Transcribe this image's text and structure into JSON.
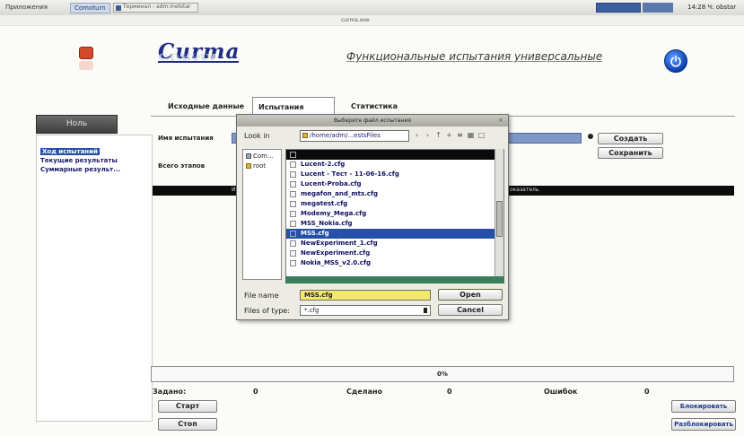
{
  "taskbar": {
    "apps_label": "Приложения",
    "app2_label": "Comoturn",
    "window_label": "Терминал - adm:inetstar",
    "clock": "14:28 Ч: obstar"
  },
  "window": {
    "title": "curma.exe"
  },
  "header": {
    "logo": "Curma",
    "logo_reflection": "CURMA",
    "app_title": "Функциональные испытания универсальные",
    "power_icon": "power-icon",
    "logo_icon": "app-logo-icon"
  },
  "left_panel": {
    "title": "Ноль",
    "items": [
      {
        "label": "Ход испытаний",
        "selected": true
      },
      {
        "label": "Текущие результаты",
        "selected": false
      },
      {
        "label": "Суммарные результ...",
        "selected": false
      }
    ]
  },
  "tabs": [
    {
      "label": "Исходные данные",
      "active": false
    },
    {
      "label": "Испытания",
      "active": true
    },
    {
      "label": "Статистика",
      "active": false
    }
  ],
  "form": {
    "test_name_label": "Имя испытания",
    "total_stages_label": "Всего этапов",
    "create_button": "Создать",
    "save_button": "Сохранить",
    "stage_bar_left": "Ин",
    "stage_bar_right": "оказатель"
  },
  "progress": {
    "value_percent": 0,
    "label": "0%"
  },
  "stats": {
    "assigned_label": "Задано:",
    "assigned_value": "0",
    "done_label": "Сделано",
    "done_value": "0",
    "errors_label": "Ошибок",
    "errors_value": "0"
  },
  "controls": {
    "start_button": "Старт",
    "stop_button": "Стоп",
    "lock_button": "Блокировать",
    "unlock_button": "Разблокировать"
  },
  "dialog": {
    "title": "Выберите файл испытания",
    "look_in_label": "Look in",
    "look_in_value": "/home/adm/...estsFiles",
    "places": [
      {
        "label": "Com...",
        "icon": "computer-icon"
      },
      {
        "label": "root",
        "icon": "folder-icon"
      }
    ],
    "files": [
      {
        "name": "",
        "style": "black"
      },
      {
        "name": "Lucent-2.cfg",
        "style": "normal"
      },
      {
        "name": "Lucent - Тест - 11-06-16.cfg",
        "style": "normal"
      },
      {
        "name": "Lucent-Proba.cfg",
        "style": "normal"
      },
      {
        "name": "megafon_and_mts.cfg",
        "style": "normal"
      },
      {
        "name": "megatest.cfg",
        "style": "normal"
      },
      {
        "name": "Modemy_Mega.cfg",
        "style": "normal"
      },
      {
        "name": "MSS_Nokia.cfg",
        "style": "normal"
      },
      {
        "name": "MSS.cfg",
        "style": "selected"
      },
      {
        "name": "NewExperiment_1.cfg",
        "style": "normal"
      },
      {
        "name": "NewExperiment.cfg",
        "style": "normal"
      },
      {
        "name": "Nokia_MSS_v2.0.cfg",
        "style": "normal"
      }
    ],
    "file_name_label": "File name",
    "file_name_value": "MSS.cfg",
    "files_of_type_label": "Files of type:",
    "files_of_type_value": "*.cfg",
    "open_button": "Open",
    "cancel_button": "Cancel"
  }
}
